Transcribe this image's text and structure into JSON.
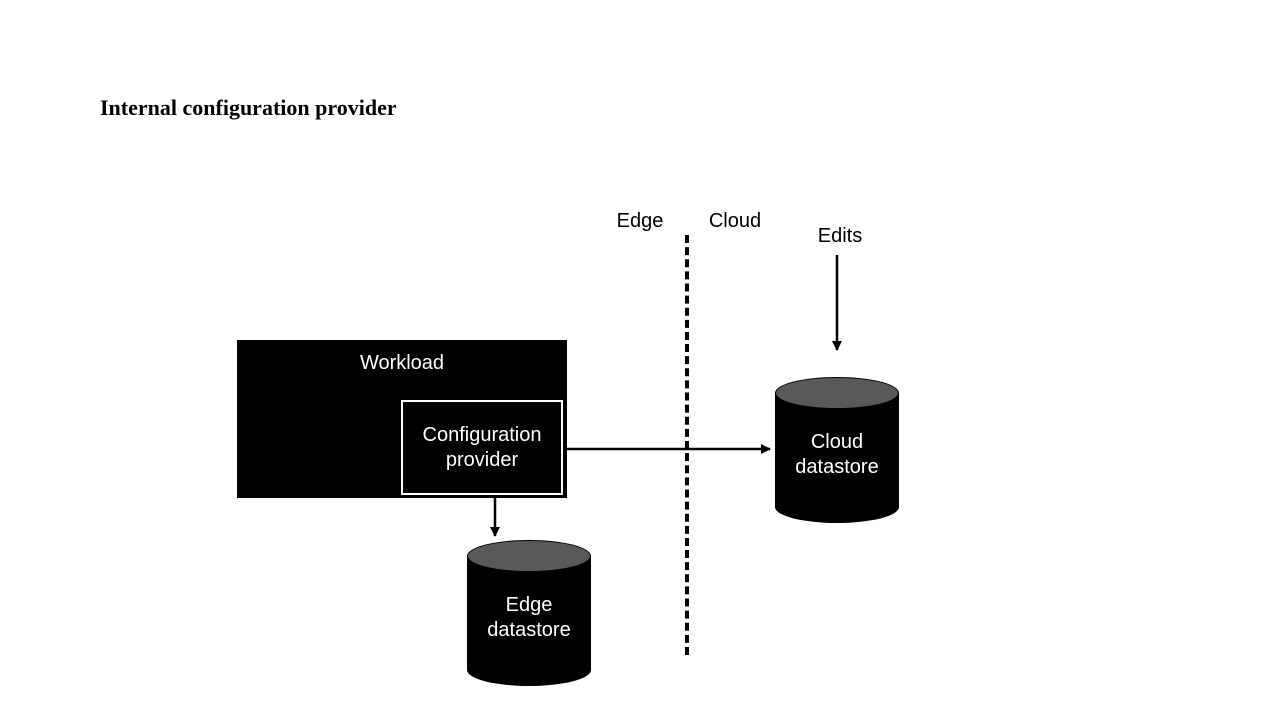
{
  "title": "Internal configuration provider",
  "regions": {
    "edge_label": "Edge",
    "cloud_label": "Cloud"
  },
  "edits_label": "Edits",
  "workload": {
    "title": "Workload",
    "config_provider": "Configuration\nprovider"
  },
  "edge_datastore": "Edge\ndatastore",
  "cloud_datastore": "Cloud\ndatastore"
}
